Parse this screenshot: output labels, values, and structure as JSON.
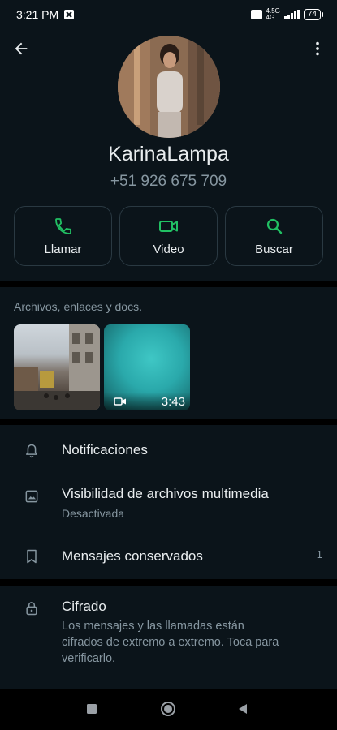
{
  "status_bar": {
    "time": "3:21 PM",
    "network": "4.5G",
    "lte": "4G",
    "battery": "74"
  },
  "icons": {
    "back": "arrow-left-icon",
    "menu": "more-vert-icon",
    "call": "phone-icon",
    "video": "videocam-icon",
    "search": "search-icon",
    "notifications": "bell-icon",
    "media": "image-icon",
    "kept": "bookmark-icon",
    "encryption": "lock-icon"
  },
  "colors": {
    "background": "#0b141a",
    "accent": "#21c063",
    "text_primary": "#e9edef",
    "text_secondary": "#8696a0",
    "border": "#2a3942"
  },
  "contact": {
    "name": "KarinaLampa",
    "phone": "+51 926 675 709"
  },
  "actions": [
    {
      "label": "Llamar"
    },
    {
      "label": "Video"
    },
    {
      "label": "Buscar"
    }
  ],
  "media": {
    "title": "Archivos, enlaces y docs.",
    "items": [
      {
        "kind": "image"
      },
      {
        "kind": "video",
        "duration": "3:43"
      }
    ]
  },
  "settings": {
    "notifications": {
      "title": "Notificaciones"
    },
    "media_visibility": {
      "title": "Visibilidad de archivos multimedia",
      "subtitle": "Desactivada"
    },
    "kept_messages": {
      "title": "Mensajes conservados",
      "count": "1"
    }
  },
  "encryption": {
    "title": "Cifrado",
    "lines": [
      "Los mensajes y las llamadas están",
      "cifrados de extremo a extremo. Toca para",
      "verificarlo."
    ]
  }
}
